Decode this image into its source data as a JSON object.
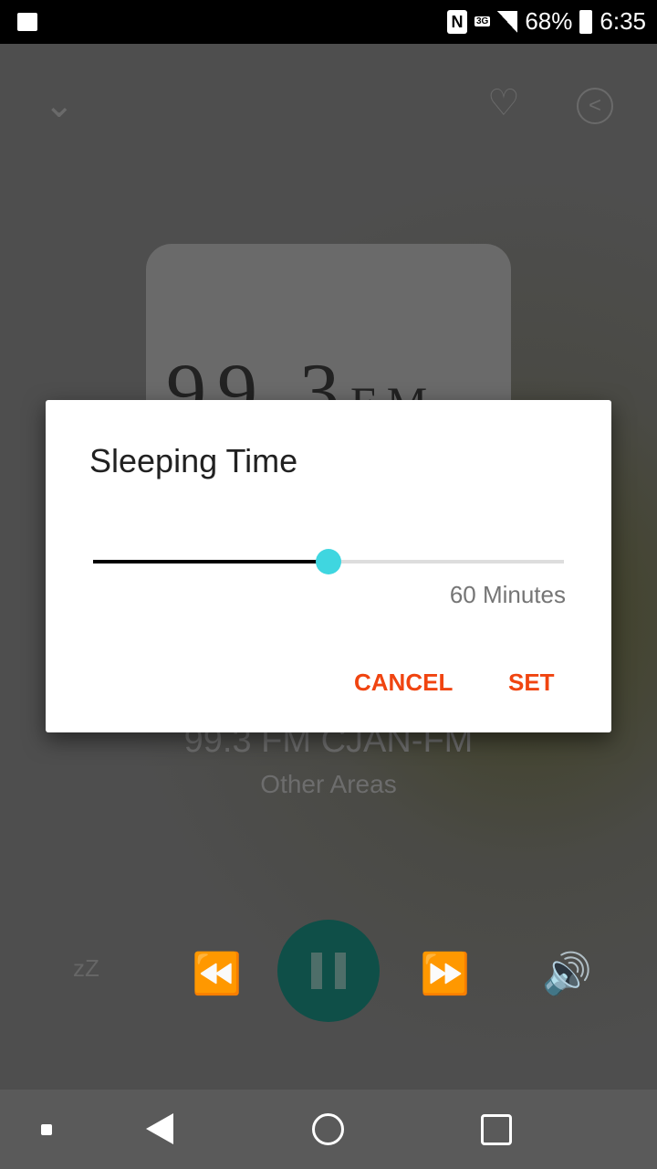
{
  "status_bar": {
    "battery": "68%",
    "time": "6:35",
    "network": "3G"
  },
  "player": {
    "station_name": "99.3 FM CJAN-FM",
    "station_area": "Other Areas",
    "logo_text": "99.3FM"
  },
  "dialog": {
    "title": "Sleeping Time",
    "slider_value_label": "60 Minutes",
    "slider_fraction": 0.5,
    "cancel_label": "CANCEL",
    "set_label": "SET"
  },
  "colors": {
    "accent": "#f04410",
    "slider_thumb": "#3fd6e0",
    "play_button": "#0f4f48"
  }
}
